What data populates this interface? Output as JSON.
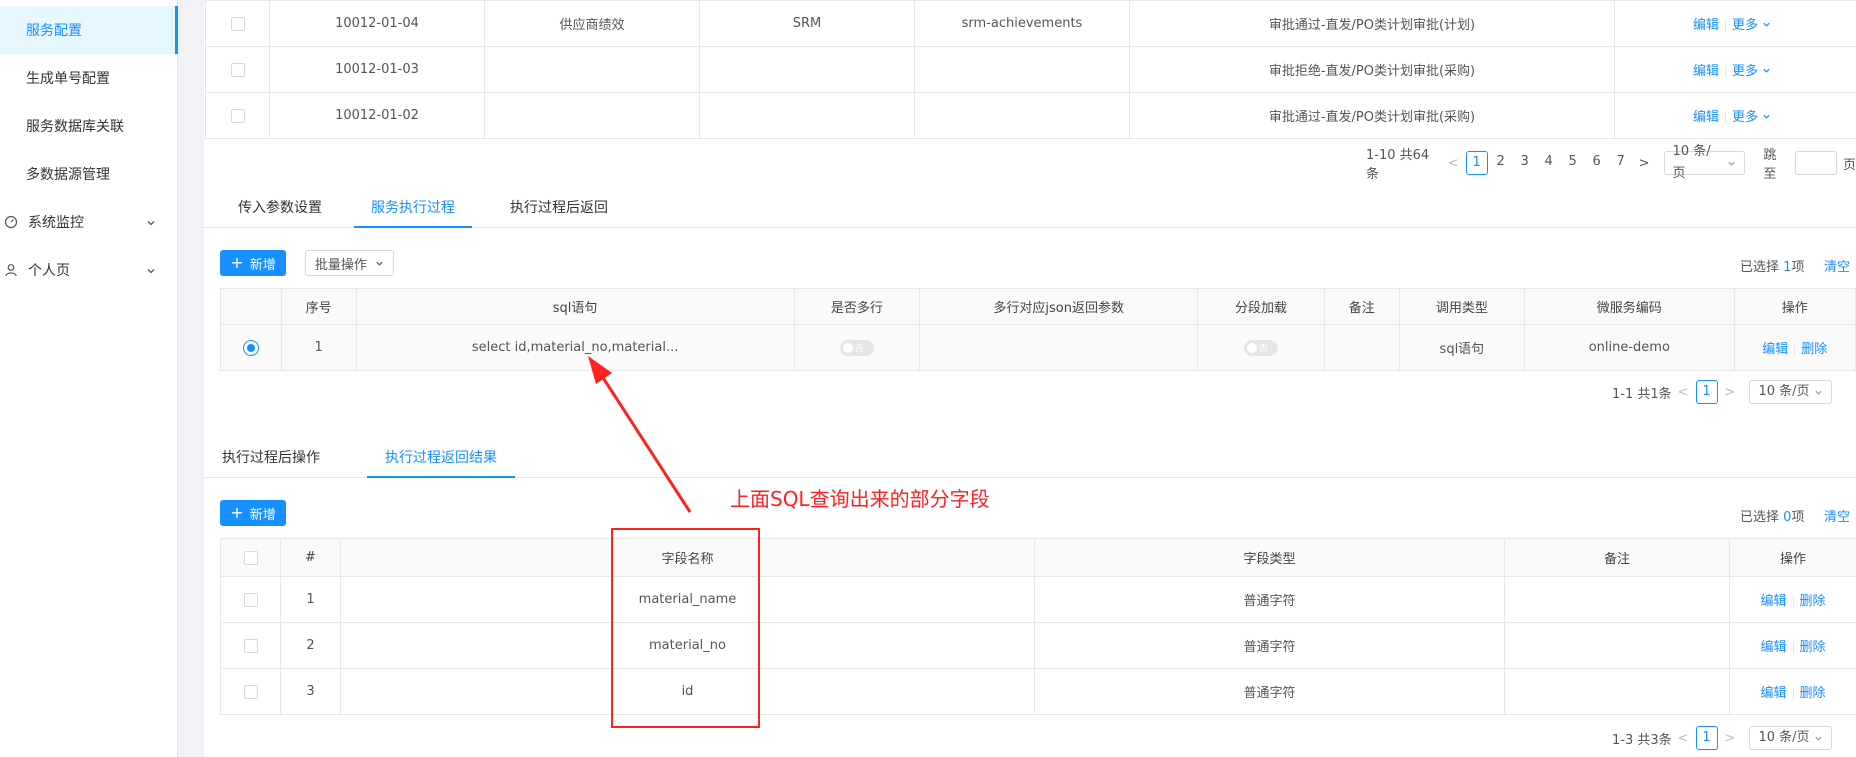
{
  "sidebar": {
    "items": [
      {
        "label": "服务配置",
        "active": true
      },
      {
        "label": "生成单号配置"
      },
      {
        "label": "服务数据库关联"
      },
      {
        "label": "多数据源管理"
      }
    ],
    "groups": [
      {
        "label": "系统监控",
        "icon": "dashboard-icon"
      },
      {
        "label": "个人页",
        "icon": "user-icon"
      }
    ]
  },
  "top_table": {
    "rows": [
      {
        "code": "10012-01-04",
        "name": "供应商绩效",
        "system": "SRM",
        "key": "srm-achievements",
        "desc": "审批通过-直发/PO类计划审批(计划)"
      },
      {
        "code": "10012-01-03",
        "name": "",
        "system": "",
        "key": "",
        "desc": "审批拒绝-直发/PO类计划审批(采购)"
      },
      {
        "code": "10012-01-02",
        "name": "",
        "system": "",
        "key": "",
        "desc": "审批通过-直发/PO类计划审批(采购)"
      }
    ],
    "edit": "编辑",
    "more": "更多",
    "pager": {
      "total": "1-10 共64条",
      "pages": [
        "1",
        "2",
        "3",
        "4",
        "5",
        "6",
        "7"
      ],
      "current": "1",
      "size": "10 条/页",
      "jump_label": "跳至",
      "page_suffix": "页"
    }
  },
  "tabs1": [
    "传入参数设置",
    "服务执行过程",
    "执行过程后返回"
  ],
  "exec": {
    "add": "新增",
    "batch": "批量操作",
    "selected_prefix": "已选择",
    "selected_count": "1",
    "selected_suffix": "项",
    "clear": "清空",
    "headers": [
      "序号",
      "sql语句",
      "是否多行",
      "多行对应json返回参数",
      "分段加载",
      "备注",
      "调用类型",
      "微服务编码",
      "操作"
    ],
    "row": {
      "no": "1",
      "sql": "select id,material_no,material...",
      "multi": "否",
      "json": "",
      "segment": "否",
      "note": "",
      "call_type": "sql语句",
      "ms_code": "online-demo",
      "edit": "编辑",
      "delete": "删除"
    },
    "pager": {
      "total": "1-1 共1条",
      "current": "1",
      "size": "10 条/页"
    }
  },
  "tabs2": [
    "执行过程后操作",
    "执行过程返回结果"
  ],
  "result": {
    "add": "新增",
    "selected_prefix": "已选择",
    "selected_count": "0",
    "selected_suffix": "项",
    "clear": "清空",
    "headers": [
      "#",
      "字段名称",
      "字段类型",
      "备注",
      "操作"
    ],
    "rows": [
      {
        "no": "1",
        "field": "material_name",
        "type": "普通字符",
        "note": ""
      },
      {
        "no": "2",
        "field": "material_no",
        "type": "普通字符",
        "note": ""
      },
      {
        "no": "3",
        "field": "id",
        "type": "普通字符",
        "note": ""
      }
    ],
    "edit": "编辑",
    "delete": "删除",
    "pager": {
      "total": "1-3 共3条",
      "current": "1",
      "size": "10 条/页"
    }
  },
  "annotation": {
    "text": "上面SQL查询出来的部分字段",
    "color": "#ff2020"
  },
  "colors": {
    "accent": "#1890ff",
    "annotation": "#ff2020"
  }
}
